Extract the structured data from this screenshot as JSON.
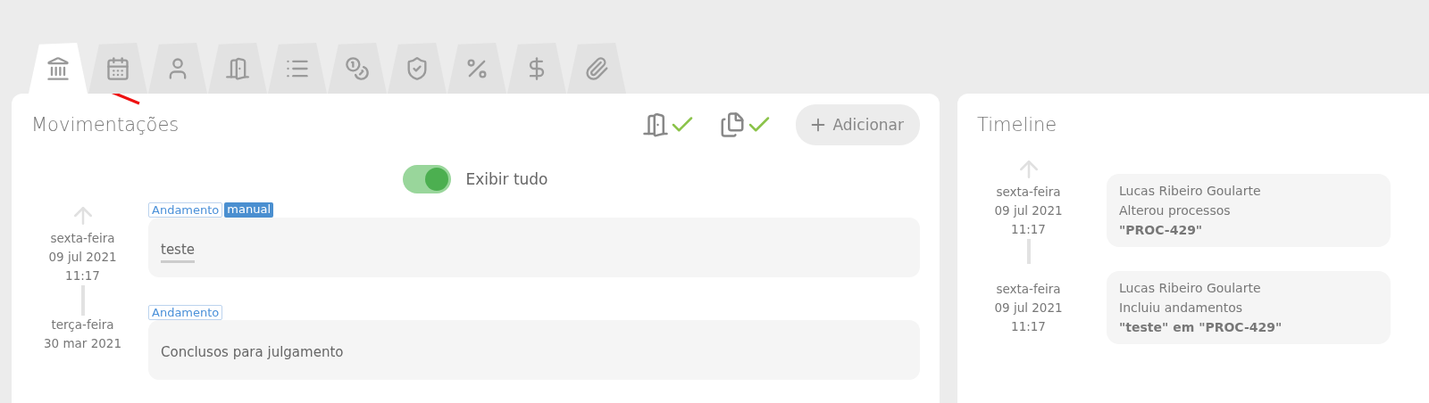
{
  "tabs": [
    {
      "selected": true
    },
    {
      "selected": false
    },
    {
      "selected": false
    },
    {
      "selected": false
    },
    {
      "selected": false
    },
    {
      "selected": false
    },
    {
      "selected": false
    },
    {
      "selected": false
    },
    {
      "selected": false
    },
    {
      "selected": false
    }
  ],
  "movements": {
    "title": "Movimentações",
    "add_button": "Adicionar",
    "toggle": {
      "label": "Exibir tudo",
      "on": true
    },
    "entries": [
      {
        "weekday": "sexta-feira",
        "date": "09 jul 2021",
        "time": "11:17",
        "tag": "Andamento",
        "badge": "manual",
        "text": "teste",
        "underlined": true
      },
      {
        "weekday": "terça-feira",
        "date": "30 mar 2021",
        "tag": "Andamento",
        "text": "Conclusos para julgamento",
        "underlined": false
      }
    ]
  },
  "timeline": {
    "title": "Timeline",
    "events": [
      {
        "weekday": "sexta-feira",
        "date": "09 jul 2021",
        "time": "11:17",
        "author": "Lucas Ribeiro Goularte",
        "action": "Alterou processos",
        "detail": "\"PROC-429\""
      },
      {
        "weekday": "sexta-feira",
        "date": "09 jul 2021",
        "time": "11:17",
        "author": "Lucas Ribeiro Goularte",
        "action": "Incluiu andamentos",
        "detail": "\"teste\" em \"PROC-429\""
      }
    ]
  }
}
